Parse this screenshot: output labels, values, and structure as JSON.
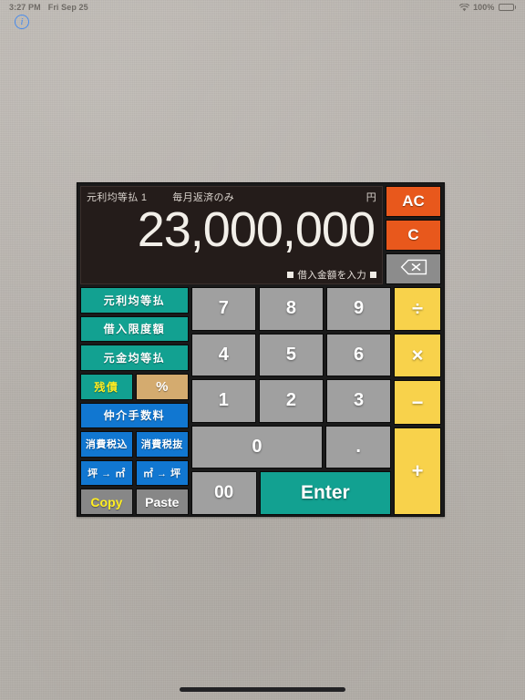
{
  "status_bar": {
    "time": "3:27 PM",
    "date": "Fri Sep 25",
    "wifi_icon": "wifi-icon",
    "battery_percent": "100%",
    "battery_icon": "battery-full-icon"
  },
  "info_button": {
    "label": "i",
    "name": "info-icon"
  },
  "calculator": {
    "display": {
      "mode_label": "元利均等払 1",
      "sub_label": "毎月返済のみ",
      "unit_label": "円",
      "value": "23,000,000",
      "hint_left_marker": "■",
      "hint_text": "借入金額を入力",
      "hint_right_marker": "■"
    },
    "clear_keys": {
      "all_clear": "AC",
      "clear": "C",
      "delete_icon": "backspace-icon"
    },
    "function_keys": [
      {
        "label": "元利均等払",
        "color": "#12a191",
        "style": "teal"
      },
      {
        "label": "借入限度額",
        "color": "#12a191",
        "style": "teal"
      },
      {
        "label": "元金均等払",
        "color": "#12a191",
        "style": "teal"
      },
      {
        "label": "残債",
        "color": "#12a191",
        "style": "teal-yellow"
      },
      {
        "label": "%",
        "color": "#d4ab6f",
        "style": "tan"
      },
      {
        "label": "仲介手数料",
        "color": "#1177d1",
        "style": "blue"
      },
      {
        "label": "消費税込",
        "color": "#1177d1",
        "style": "blue"
      },
      {
        "label": "消費税抜",
        "color": "#1177d1",
        "style": "blue"
      },
      {
        "label": "坪 → ㎡",
        "color": "#1177d1",
        "style": "blue"
      },
      {
        "label": "㎡ → 坪",
        "color": "#1177d1",
        "style": "blue"
      },
      {
        "label": "Copy",
        "color": "#878787",
        "style": "gray-yellow"
      },
      {
        "label": "Paste",
        "color": "#878787",
        "style": "gray"
      }
    ],
    "number_keys": {
      "row1": [
        "7",
        "8",
        "9"
      ],
      "row2": [
        "4",
        "5",
        "6"
      ],
      "row3": [
        "1",
        "2",
        "3"
      ],
      "zero": "0",
      "decimal": ".",
      "double_zero": "00",
      "enter": "Enter"
    },
    "operator_keys": {
      "divide": "÷",
      "multiply": "×",
      "minus": "−",
      "plus": "+"
    },
    "colors": {
      "accent_orange": "#e8581c",
      "accent_teal": "#12a191",
      "accent_blue": "#1177d1",
      "accent_yellow": "#f8d24b",
      "accent_tan": "#d4ab6f",
      "key_gray": "#a0a0a0",
      "frame_black": "#1a1a1a",
      "display_bg": "#241c1a",
      "page_bg": "#b7b2ac"
    }
  },
  "home_indicator": "home-indicator"
}
